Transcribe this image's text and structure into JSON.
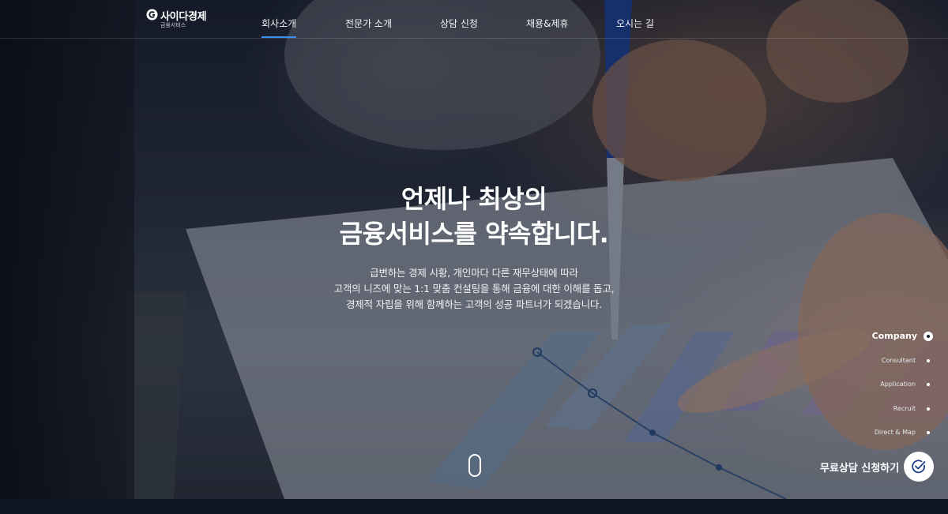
{
  "brand": {
    "name": "사이다경제",
    "sub": "금융서비스"
  },
  "nav": {
    "items": [
      {
        "label": "회사소개",
        "active": true
      },
      {
        "label": "전문가 소개",
        "active": false
      },
      {
        "label": "상담 신청",
        "active": false
      },
      {
        "label": "채용&제휴",
        "active": false
      },
      {
        "label": "오시는 길",
        "active": false
      }
    ]
  },
  "hero": {
    "headline_1": "언제나 최상의",
    "headline_2": "금융서비스를 약속합니다.",
    "desc_1": "급변하는 경제 시황, 개인마다 다른 재무상태에 따라",
    "desc_2": "고객의 니즈에 맞는 1:1 맞춤 컨설팅을 통해 금융에 대한 이해를 돕고,",
    "desc_3": "경제적 자립을 위해 함께하는 고객의 성공 파트너가 되겠습니다."
  },
  "side_nav": {
    "items": [
      {
        "label": "Company",
        "active": true
      },
      {
        "label": "Consultant",
        "active": false
      },
      {
        "label": "Application",
        "active": false
      },
      {
        "label": "Recruit",
        "active": false
      },
      {
        "label": "Direct & Map",
        "active": false
      }
    ]
  },
  "cta": {
    "label": "무료상담 신청하기",
    "icon": "check-circle-icon"
  },
  "colors": {
    "accent": "#3d8ef0",
    "background": "#0f1520"
  }
}
